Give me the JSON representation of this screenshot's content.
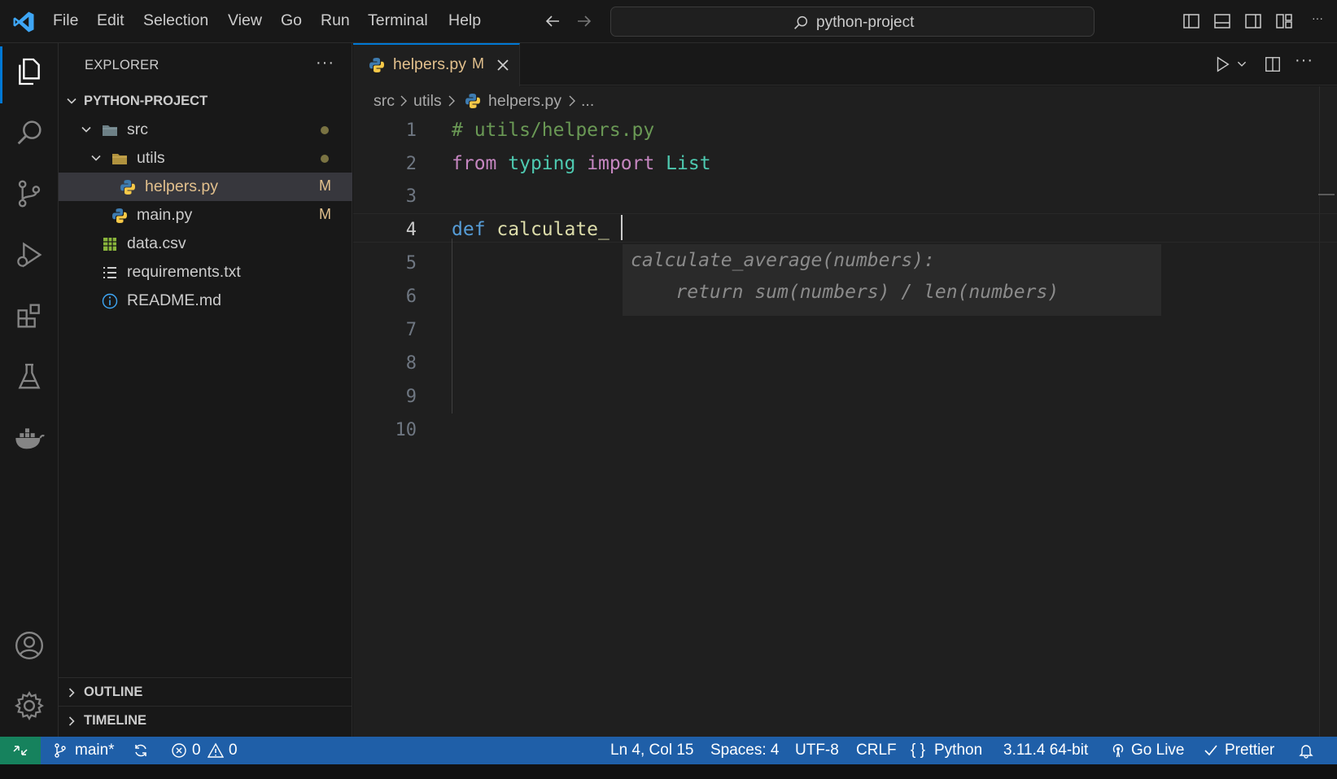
{
  "titlebar": {
    "menu": [
      "File",
      "Edit",
      "Selection",
      "View",
      "Go",
      "Run",
      "Terminal",
      "Help"
    ],
    "search_text": "python-project",
    "more": "···"
  },
  "sidebar": {
    "title": "EXPLORER",
    "more": "···",
    "project": "PYTHON-PROJECT",
    "items": [
      {
        "label": "src",
        "type": "folder"
      },
      {
        "label": "utils",
        "type": "folder"
      },
      {
        "label": "helpers.py",
        "type": "python",
        "badge": "M",
        "selected": true
      },
      {
        "label": "main.py",
        "type": "python",
        "badge": "M"
      },
      {
        "label": "data.csv",
        "type": "csv"
      },
      {
        "label": "requirements.txt",
        "type": "text"
      },
      {
        "label": "README.md",
        "type": "info"
      }
    ],
    "outline": "OUTLINE",
    "timeline": "TIMELINE"
  },
  "tab": {
    "name": "helpers.py",
    "badge": "M"
  },
  "breadcrumb": [
    "src",
    "utils",
    "helpers.py",
    "..."
  ],
  "editor": {
    "line_numbers": [
      "1",
      "2",
      "3",
      "4",
      "5",
      "6",
      "7",
      "8",
      "9",
      "10"
    ],
    "line1": "# utils/helpers.py",
    "line2_from": "from",
    "line2_module": "typing",
    "line2_import": "import",
    "line2_name": "List",
    "line4_def": "def",
    "line4_name": "calculate_",
    "ghost_line1": "calculate_average(numbers):",
    "ghost_line2": "    return sum(numbers) / len(numbers)"
  },
  "statusbar": {
    "branch": "main*",
    "errors": "0",
    "warnings": "0",
    "position": "Ln 4, Col 15",
    "spaces": "Spaces: 4",
    "encoding": "UTF-8",
    "eol": "CRLF",
    "language": "Python",
    "interpreter": "3.11.4 64-bit",
    "go_live": "Go Live",
    "prettier": "Prettier"
  },
  "colors": {
    "accent": "#0078d4",
    "modified": "#e2c08d",
    "statusbar": "#1f5fa8"
  }
}
